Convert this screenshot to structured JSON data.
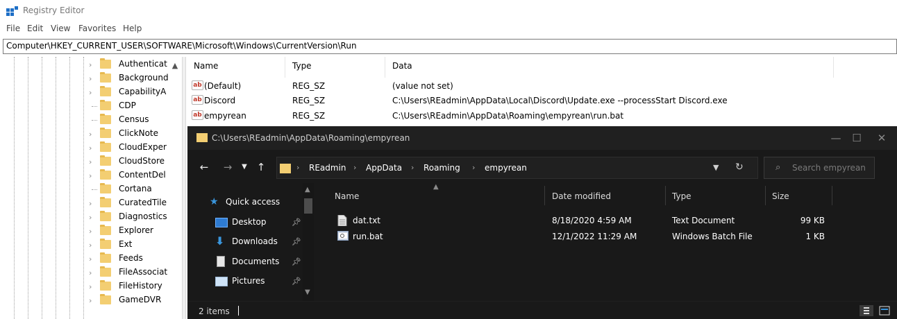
{
  "registry": {
    "window_title": "Registry Editor",
    "menu": [
      "File",
      "Edit",
      "View",
      "Favorites",
      "Help"
    ],
    "address": "Computer\\HKEY_CURRENT_USER\\SOFTWARE\\Microsoft\\Windows\\CurrentVersion\\Run",
    "tree_items": [
      {
        "label": "Authenticat",
        "expandable": true
      },
      {
        "label": "Background",
        "expandable": true
      },
      {
        "label": "CapabilityA",
        "expandable": true
      },
      {
        "label": "CDP",
        "expandable": false
      },
      {
        "label": "Census",
        "expandable": false
      },
      {
        "label": "ClickNote",
        "expandable": true
      },
      {
        "label": "CloudExper",
        "expandable": true
      },
      {
        "label": "CloudStore",
        "expandable": true
      },
      {
        "label": "ContentDel",
        "expandable": true
      },
      {
        "label": "Cortana",
        "expandable": false
      },
      {
        "label": "CuratedTile",
        "expandable": true
      },
      {
        "label": "Diagnostics",
        "expandable": true
      },
      {
        "label": "Explorer",
        "expandable": true
      },
      {
        "label": "Ext",
        "expandable": true
      },
      {
        "label": "Feeds",
        "expandable": true
      },
      {
        "label": "FileAssociat",
        "expandable": true
      },
      {
        "label": "FileHistory",
        "expandable": true
      },
      {
        "label": "GameDVR",
        "expandable": true
      }
    ],
    "columns": {
      "name": "Name",
      "type": "Type",
      "data": "Data"
    },
    "values": [
      {
        "name": "(Default)",
        "type": "REG_SZ",
        "data": "(value not set)"
      },
      {
        "name": "Discord",
        "type": "REG_SZ",
        "data": "C:\\Users\\REadmin\\AppData\\Local\\Discord\\Update.exe --processStart Discord.exe"
      },
      {
        "name": "empyrean",
        "type": "REG_SZ",
        "data": "C:\\Users\\REadmin\\AppData\\Roaming\\empyrean\\run.bat"
      }
    ],
    "value_icon_text": "ab"
  },
  "explorer": {
    "window_title": "C:\\Users\\REadmin\\AppData\\Roaming\\empyrean",
    "window_buttons": {
      "minimize": "—",
      "maximize": "☐",
      "close": "✕"
    },
    "breadcrumbs": [
      "REadmin",
      "AppData",
      "Roaming",
      "empyrean"
    ],
    "search_placeholder": "Search empyrean",
    "nav_items": [
      {
        "label": "Quick access",
        "icon": "star-icon",
        "pinned": false
      },
      {
        "label": "Desktop",
        "icon": "desktop-icon",
        "pinned": true
      },
      {
        "label": "Downloads",
        "icon": "download-icon",
        "pinned": true
      },
      {
        "label": "Documents",
        "icon": "documents-icon",
        "pinned": true
      },
      {
        "label": "Pictures",
        "icon": "pictures-icon",
        "pinned": true
      }
    ],
    "columns": {
      "name": "Name",
      "date": "Date modified",
      "type": "Type",
      "size": "Size"
    },
    "files": [
      {
        "name": "dat.txt",
        "date": "8/18/2020 4:59 AM",
        "type": "Text Document",
        "size": "99 KB",
        "icon": "text-file-icon"
      },
      {
        "name": "run.bat",
        "date": "12/1/2022 11:29 AM",
        "type": "Windows Batch File",
        "size": "1 KB",
        "icon": "batch-file-icon"
      }
    ],
    "status": "2 items"
  },
  "colors": {
    "folder": "#f3ce72",
    "explorer_bg": "#191919",
    "explorer_title_bg": "#202020",
    "quick_access_star": "#3a96dd"
  }
}
